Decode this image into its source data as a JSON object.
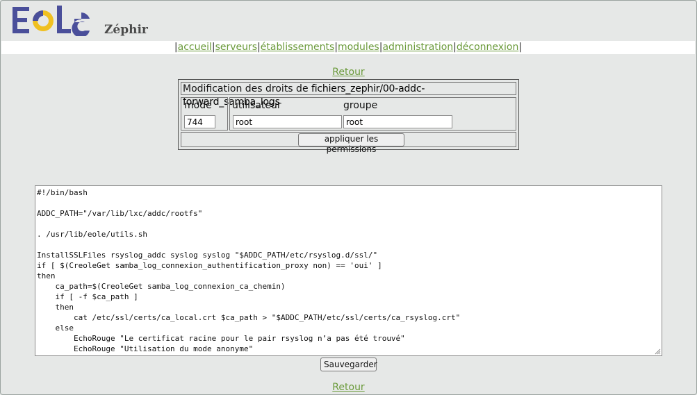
{
  "app": {
    "name": "Zéphir",
    "logo_text": "EOLE"
  },
  "nav": {
    "items": [
      {
        "label": "accueil"
      },
      {
        "label": "serveurs"
      },
      {
        "label": "établissements"
      },
      {
        "label": "modules"
      },
      {
        "label": "administration"
      },
      {
        "label": "déconnexion"
      }
    ]
  },
  "links": {
    "retour_top": "Retour",
    "retour_bottom": "Retour"
  },
  "permissions": {
    "title_prefix": "Modification des droits de ",
    "file_path": "fichiers_zephir/00-addc-forward_samba_logs",
    "mode_label": "mode",
    "mode_value": "744",
    "user_label": "utilisateur",
    "user_value": "root",
    "group_label": "groupe",
    "group_value": "root",
    "apply_button": "appliquer les permissions"
  },
  "editor": {
    "content": "#!/bin/bash\n\nADDC_PATH=\"/var/lib/lxc/addc/rootfs\"\n\n. /usr/lib/eole/utils.sh\n\nInstallSSLFiles rsyslog_addc syslog syslog \"$ADDC_PATH/etc/rsyslog.d/ssl/\"\nif [ $(CreoleGet samba_log_connexion_authentification_proxy non) == 'oui' ]\nthen\n    ca_path=$(CreoleGet samba_log_connexion_ca_chemin)\n    if [ -f $ca_path ]\n    then\n        cat /etc/ssl/certs/ca_local.crt $ca_path > \"$ADDC_PATH/etc/ssl/certs/ca_rsyslog.crt\"\n    else\n        EchoRouge \"Le certificat racine pour le pair rsyslog n’a pas été trouvé\"\n        EchoRouge \"Utilisation du mode anonyme\"",
    "save_button": "Sauvegarder"
  },
  "colors": {
    "link": "#6a9a3a",
    "logo_blue": "#4a4f9a",
    "logo_yellow": "#f0c020",
    "background": "#e6e8e7"
  }
}
